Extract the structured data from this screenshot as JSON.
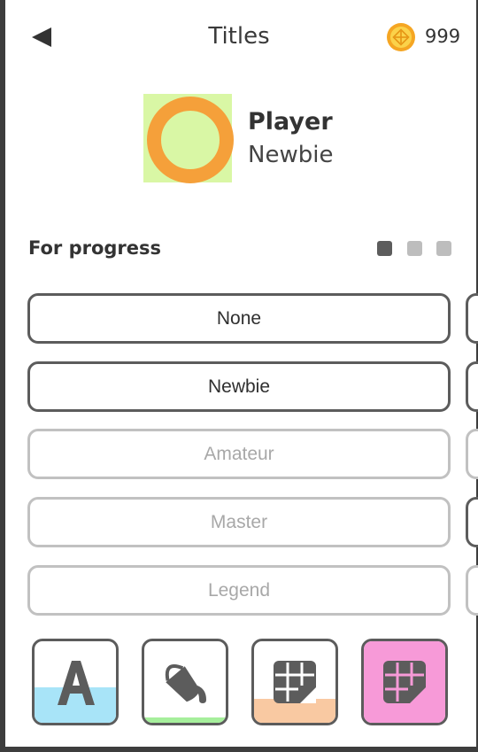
{
  "header": {
    "title": "Titles",
    "back_icon": "back-arrow-icon",
    "coin_icon": "coin-icon",
    "coins": "999"
  },
  "player": {
    "name": "Player",
    "current_title": "Newbie",
    "avatar_fill": "#d9f7a5",
    "avatar_ring": "#f5a03a"
  },
  "section": {
    "label": "For progress",
    "page_count": 3,
    "active_page": 1
  },
  "options": [
    {
      "label": "None",
      "unlocked": true
    },
    {
      "label": "Newbie",
      "unlocked": true
    },
    {
      "label": "Amateur",
      "unlocked": false
    },
    {
      "label": "Master",
      "unlocked": false
    },
    {
      "label": "Legend",
      "unlocked": false
    }
  ],
  "next_column_unlocked": [
    true,
    true,
    false,
    true,
    false
  ],
  "tabs": [
    {
      "icon": "font-icon",
      "accent": "#a8e4f8",
      "level": 0.43
    },
    {
      "icon": "paint-bucket-icon",
      "accent": "#a6ef9c",
      "level": 0.06
    },
    {
      "icon": "grid-pattern-icon",
      "accent": "#f9c9a2",
      "level": 0.29
    },
    {
      "icon": "grid-pattern-icon",
      "accent": "#f79ad8",
      "level": 1.0
    }
  ]
}
